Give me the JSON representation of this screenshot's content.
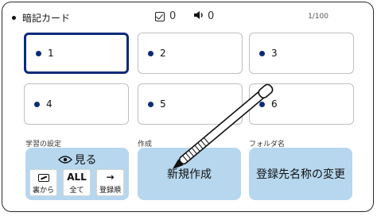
{
  "header": {
    "title": "暗記カード",
    "check_count": "0",
    "speak_count": "0",
    "page": "1/100"
  },
  "cards": [
    {
      "label": "1",
      "selected": true
    },
    {
      "label": "2",
      "selected": false
    },
    {
      "label": "3",
      "selected": false
    },
    {
      "label": "4",
      "selected": false
    },
    {
      "label": "5",
      "selected": false
    },
    {
      "label": "6",
      "selected": false
    }
  ],
  "sections": {
    "study": {
      "label": "学習の設定",
      "view_label": "見る",
      "options": [
        {
          "label": "裏から",
          "icon": "card-flip-icon"
        },
        {
          "label": "全て",
          "icon_text": "ALL"
        },
        {
          "label": "登録順",
          "icon_text": "→"
        }
      ]
    },
    "create": {
      "label": "作成",
      "button": "新規作成"
    },
    "folder": {
      "label": "フォルダ名",
      "button": "登録先名称の変更"
    }
  },
  "colors": {
    "accent": "#0b2b7a",
    "button_bg": "#b6d7ee"
  }
}
